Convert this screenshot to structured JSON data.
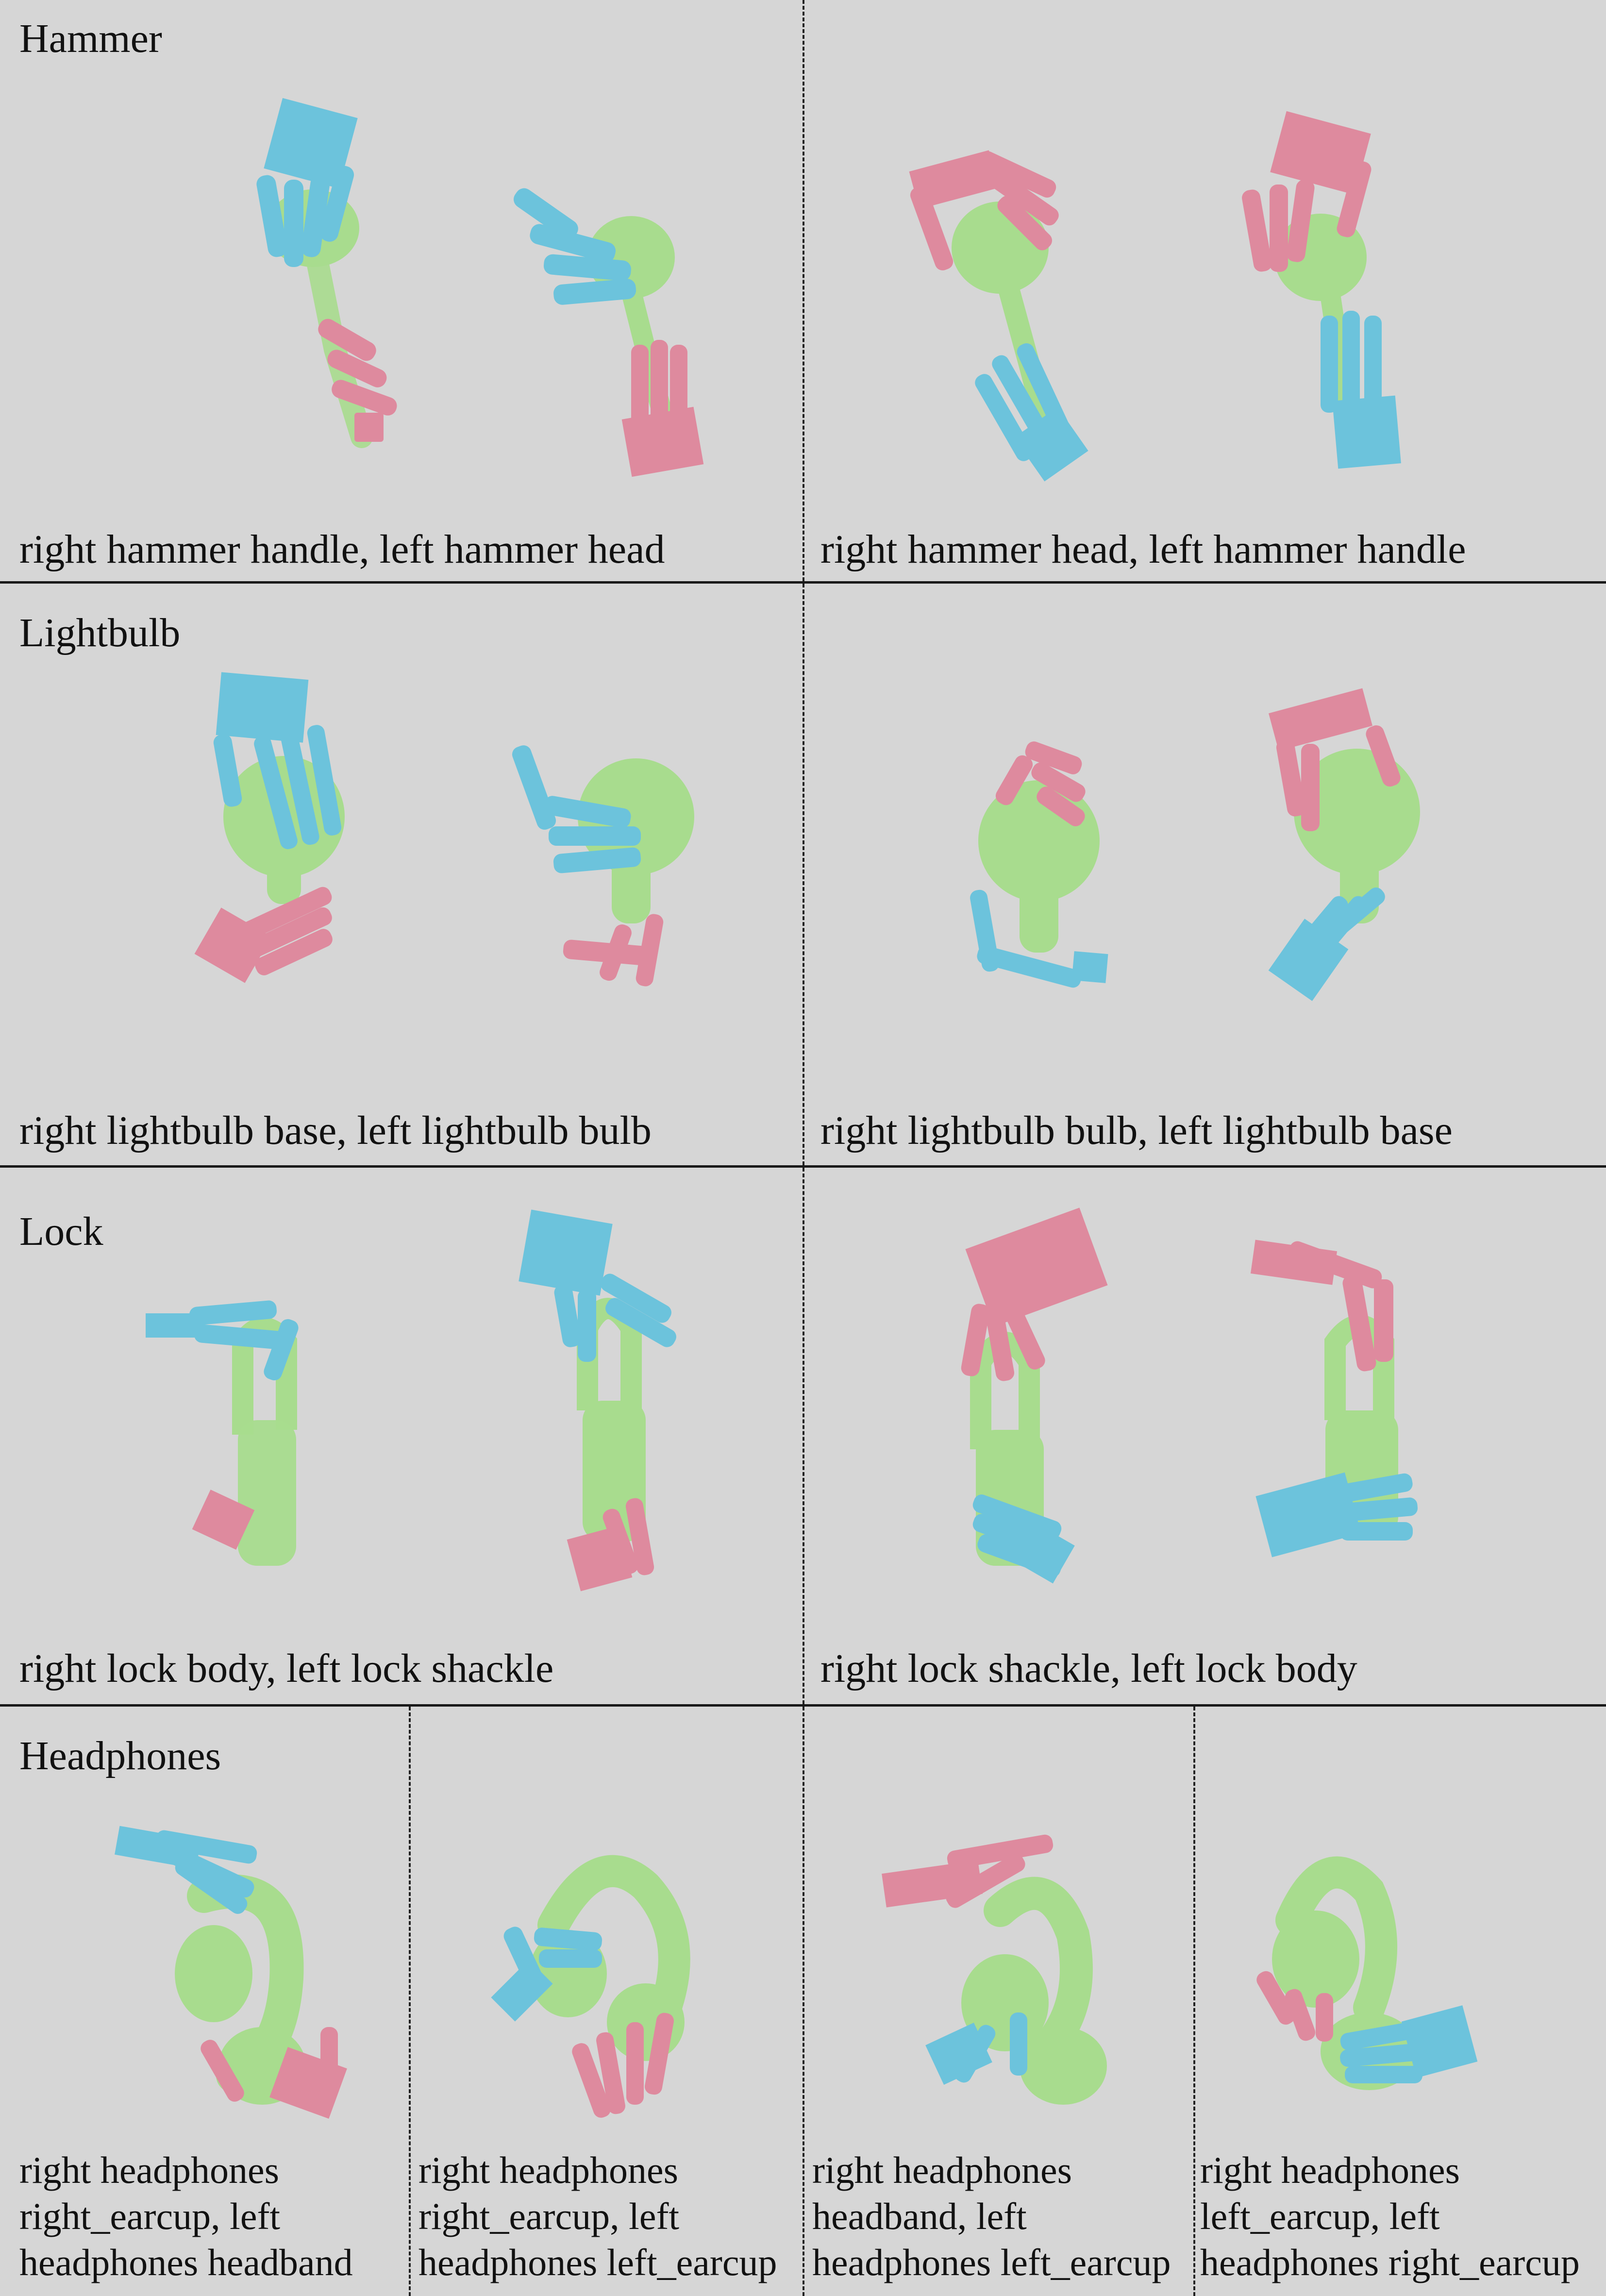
{
  "colors": {
    "background": "#d6d6d6",
    "object_green": "#a8dc8e",
    "left_hand_blue": "#6cc3dc",
    "right_hand_pink": "#de8a9e",
    "divider": "#1a1a1a"
  },
  "sections": [
    {
      "title": "Hammer",
      "captions": [
        "right hammer handle, left hammer head",
        "right hammer head, left hammer handle"
      ]
    },
    {
      "title": "Lightbulb",
      "captions": [
        "right lightbulb base, left lightbulb bulb",
        "right lightbulb bulb, left lightbulb base"
      ]
    },
    {
      "title": "Lock",
      "captions": [
        "right lock body, left lock shackle",
        "right lock shackle, left lock body"
      ]
    },
    {
      "title": "Headphones",
      "captions": [
        [
          "right headphones",
          "right_earcup, left",
          "headphones headband"
        ],
        [
          "right headphones",
          "right_earcup, left",
          "headphones left_earcup"
        ],
        [
          "right headphones",
          "headband, left",
          "headphones left_earcup"
        ],
        [
          "right headphones",
          "left_earcup, left",
          "headphones right_earcup"
        ]
      ]
    }
  ]
}
